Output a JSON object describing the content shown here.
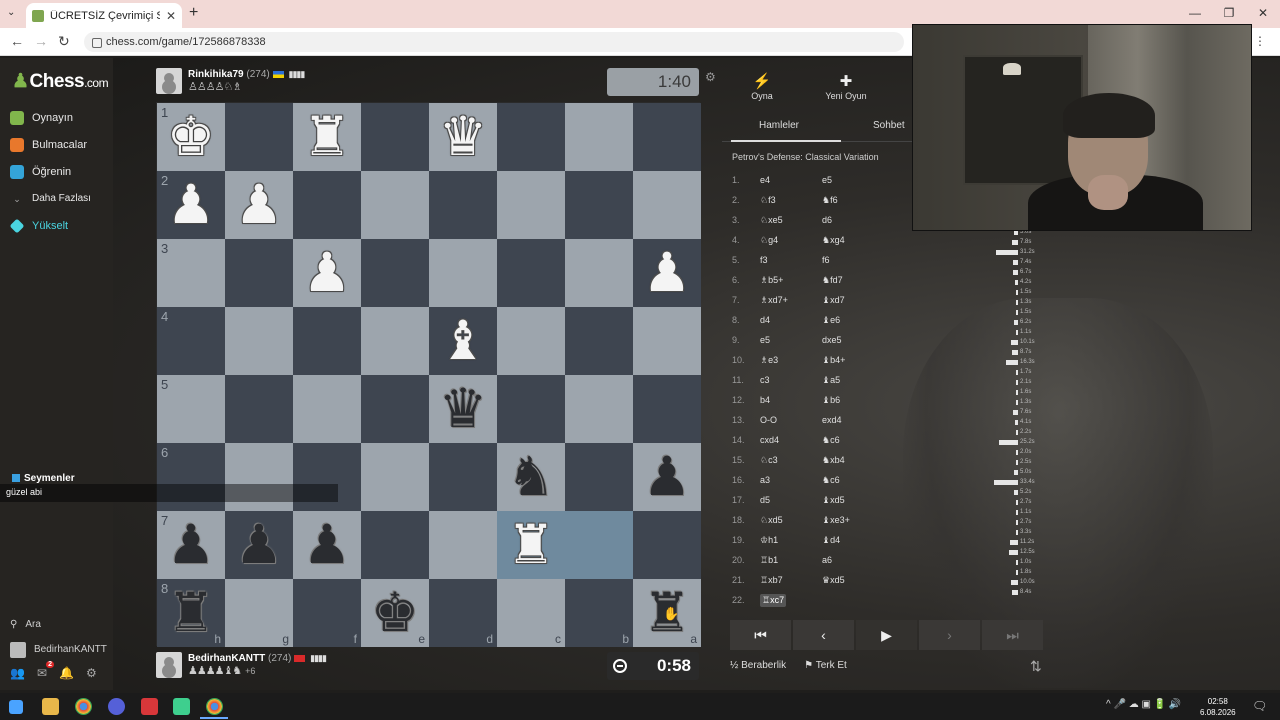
{
  "browser": {
    "tab_title": "ÜCRETSİZ Çevrimiçi Satranç Oy",
    "tab_close": "✕",
    "new_tab": "+",
    "url": "chess.com/game/172586878338",
    "win": [
      "—",
      "❐",
      "✕"
    ],
    "nav": [
      "←",
      "→",
      "↻"
    ],
    "addr_right": "⋮"
  },
  "sidebar": {
    "logo": "Chess",
    "logo_suffix": ".com",
    "items": [
      {
        "label": "Oynayın"
      },
      {
        "label": "Bulmacalar"
      },
      {
        "label": "Öğrenin"
      },
      {
        "label": "Daha Fazlası"
      },
      {
        "label": "Yükselt"
      }
    ],
    "search": "Ara",
    "username": "BedirhanKANTT",
    "mail_badge": "2"
  },
  "top_player": {
    "name": "Rinkihika79",
    "rating": "(274)",
    "bars": "▮▮▮▮",
    "captured": "♙♙♙♙♘♗",
    "clock": "1:40"
  },
  "bottom_player": {
    "name": "BedirhanKANTT",
    "rating": "(274)",
    "bars": "▮▮▮▮",
    "captured": "♟♟♟♟♝♞",
    "advantage": "+6",
    "clock": "0:58"
  },
  "board": {
    "ranks": [
      "1",
      "2",
      "3",
      "4",
      "5",
      "6",
      "7",
      "8"
    ],
    "files": [
      "h",
      "g",
      "f",
      "e",
      "d",
      "c",
      "b",
      "a"
    ],
    "pieces": {
      "r0c0": {
        "g": "♚",
        "c": "w"
      },
      "r0c2": {
        "g": "♜",
        "c": "w"
      },
      "r0c4": {
        "g": "♛",
        "c": "w"
      },
      "r1c0": {
        "g": "♟",
        "c": "w"
      },
      "r1c1": {
        "g": "♟",
        "c": "w"
      },
      "r2c2": {
        "g": "♟",
        "c": "w"
      },
      "r2c7": {
        "g": "♟",
        "c": "w"
      },
      "r3c4": {
        "g": "♝",
        "c": "w"
      },
      "r4c4": {
        "g": "♛",
        "c": "b"
      },
      "r5c5": {
        "g": "♞",
        "c": "b"
      },
      "r5c7": {
        "g": "♟",
        "c": "b"
      },
      "r6c0": {
        "g": "♟",
        "c": "b"
      },
      "r6c1": {
        "g": "♟",
        "c": "b"
      },
      "r6c2": {
        "g": "♟",
        "c": "b"
      },
      "r6c5": {
        "g": "♜",
        "c": "w"
      },
      "r7c0": {
        "g": "♜",
        "c": "b"
      },
      "r7c3": {
        "g": "♚",
        "c": "b"
      },
      "r7c7": {
        "g": "♜",
        "c": "b"
      }
    },
    "highlight": [
      "r6c5",
      "r6c6"
    ]
  },
  "chat": {
    "user": "Seymenler",
    "message": "güzel abi"
  },
  "panel": {
    "actions": [
      {
        "icon": "⚡",
        "label": "Oyna"
      },
      {
        "icon": "✚",
        "label": "Yeni Oyun"
      }
    ],
    "tabs": [
      "Hamleler",
      "Sohbet"
    ],
    "opening": "Petrov's Defense: Classical Variation",
    "moves": [
      [
        "1.",
        "e4",
        "e5"
      ],
      [
        "2.",
        "♘f3",
        "♞f6"
      ],
      [
        "3.",
        "♘xe5",
        "d6"
      ],
      [
        "4.",
        "♘g4",
        "♞xg4"
      ],
      [
        "5.",
        "f3",
        "f6"
      ],
      [
        "6.",
        "♗b5+",
        "♞fd7"
      ],
      [
        "7.",
        "♗xd7+",
        "♝xd7"
      ],
      [
        "8.",
        "d4",
        "♝e6"
      ],
      [
        "9.",
        "e5",
        "dxe5"
      ],
      [
        "10.",
        "♗e3",
        "♝b4+"
      ],
      [
        "11.",
        "c3",
        "♝a5"
      ],
      [
        "12.",
        "b4",
        "♝b6"
      ],
      [
        "13.",
        "O-O",
        "exd4"
      ],
      [
        "14.",
        "cxd4",
        "♞c6"
      ],
      [
        "15.",
        "♘c3",
        "♞xb4"
      ],
      [
        "16.",
        "a3",
        "♞c6"
      ],
      [
        "17.",
        "d5",
        "♝xd5"
      ],
      [
        "18.",
        "♘xd5",
        "♝xe3+"
      ],
      [
        "19.",
        "♔h1",
        "♝d4"
      ],
      [
        "20.",
        "♖b1",
        "a6"
      ],
      [
        "21.",
        "♖xb7",
        "♛xd5"
      ],
      [
        "22.",
        "♖xc7",
        ""
      ]
    ],
    "controls": [
      "⏮",
      "‹",
      "▶",
      "›",
      "⏭"
    ],
    "draw": "½ Beraberlik",
    "resign": "⚑ Terk Et",
    "flip": "⇅"
  },
  "time_bars": [
    {
      "label": "5.0s",
      "w": 0.18
    },
    {
      "label": "7.8s",
      "w": 0.26
    },
    {
      "label": "31.2s",
      "w": 1.0
    },
    {
      "label": "7.4s",
      "w": 0.25
    },
    {
      "label": "6.7s",
      "w": 0.22
    },
    {
      "label": "4.2s",
      "w": 0.14
    },
    {
      "label": "1.5s",
      "w": 0.05
    },
    {
      "label": "1.3s",
      "w": 0.05
    },
    {
      "label": "1.5s",
      "w": 0.05
    },
    {
      "label": "6.2s",
      "w": 0.2
    },
    {
      "label": "1.1s",
      "w": 0.04
    },
    {
      "label": "10.1s",
      "w": 0.33
    },
    {
      "label": "8.7s",
      "w": 0.29
    },
    {
      "label": "16.3s",
      "w": 0.55
    },
    {
      "label": "1.7s",
      "w": 0.06
    },
    {
      "label": "2.1s",
      "w": 0.07
    },
    {
      "label": "1.6s",
      "w": 0.05
    },
    {
      "label": "1.3s",
      "w": 0.05
    },
    {
      "label": "7.6s",
      "w": 0.25
    },
    {
      "label": "4.1s",
      "w": 0.14
    },
    {
      "label": "2.2s",
      "w": 0.07
    },
    {
      "label": "25.2s",
      "w": 0.85
    },
    {
      "label": "2.0s",
      "w": 0.07
    },
    {
      "label": "2.5s",
      "w": 0.08
    },
    {
      "label": "5.0s",
      "w": 0.17
    },
    {
      "label": "33.4s",
      "w": 1.1
    },
    {
      "label": "5.2s",
      "w": 0.17
    },
    {
      "label": "2.7s",
      "w": 0.09
    },
    {
      "label": "1.1s",
      "w": 0.04
    },
    {
      "label": "2.7s",
      "w": 0.09
    },
    {
      "label": "3.3s",
      "w": 0.11
    },
    {
      "label": "11.2s",
      "w": 0.37
    },
    {
      "label": "12.5s",
      "w": 0.42
    },
    {
      "label": "1.0s",
      "w": 0.03
    },
    {
      "label": "1.8s",
      "w": 0.06
    },
    {
      "label": "10.0s",
      "w": 0.33
    },
    {
      "label": "8.4s",
      "w": 0.28
    }
  ],
  "taskbar": {
    "time": "02:58",
    "date": "6.08.2026",
    "tray": "^ 🎤 ☁ ▣ 🔋 🔊"
  },
  "colors": {
    "light_square": "#9da5ad",
    "dark_square": "#3e4550",
    "highlight": "#6f8a9e",
    "brand_green": "#81b64c"
  }
}
